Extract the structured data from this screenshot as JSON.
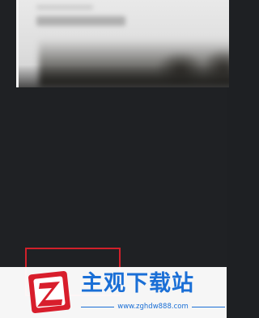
{
  "watermark": {
    "brand_text": "主观下载站",
    "site_url": "www.zghdw888.com",
    "logo_letter": "Z",
    "colors": {
      "brand_blue": "#1a6fd6",
      "logo_red": "#d81e2c",
      "highlight_red": "#d0202a"
    }
  }
}
